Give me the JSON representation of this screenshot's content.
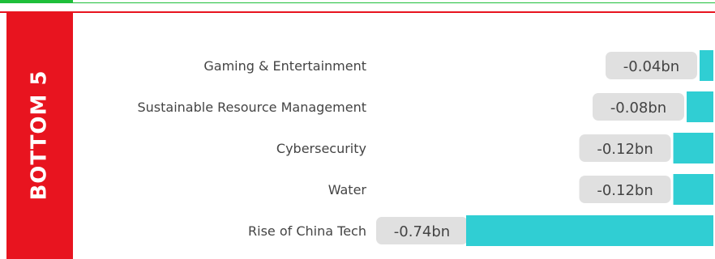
{
  "colors": {
    "accent_green": "#1fbf3a",
    "panel_red": "#e8141f",
    "bar": "#30ced3",
    "pill": "#e0e0e0",
    "label_text": "#444444"
  },
  "panel": {
    "title": "BOTTOM 5"
  },
  "chart_data": {
    "type": "bar",
    "orientation": "horizontal",
    "categories": [
      "Gaming & Entertainment",
      "Sustainable Resource Management",
      "Cybersecurity",
      "Water",
      "Rise of China Tech"
    ],
    "values": [
      -0.04,
      -0.08,
      -0.12,
      -0.12,
      -0.74
    ],
    "value_labels": [
      "-0.04bn",
      "-0.08bn",
      "-0.12bn",
      "-0.12bn",
      "-0.74bn"
    ],
    "title": "",
    "xlabel": "",
    "ylabel": "",
    "xlim": [
      -0.74,
      0
    ],
    "grid": false
  }
}
